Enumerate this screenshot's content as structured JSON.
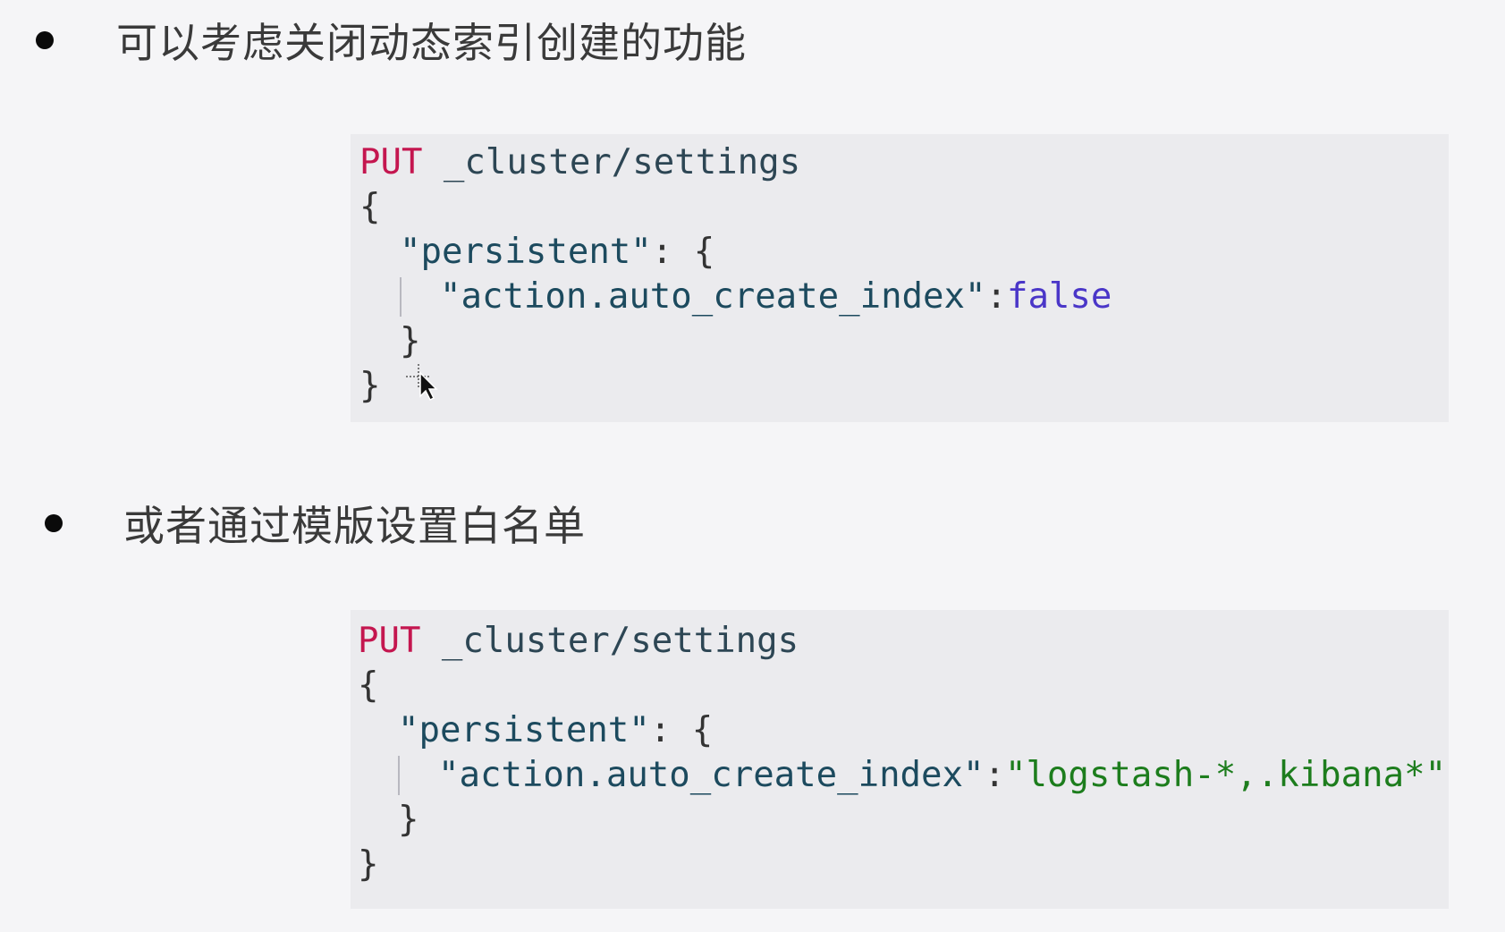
{
  "bullets": [
    {
      "text": "可以考虑关闭动态索引创建的功能"
    },
    {
      "text": "或者通过模版设置白名单"
    }
  ],
  "code_blocks": [
    {
      "method": "PUT",
      "path": " _cluster/settings",
      "open_brace": "{",
      "persistent_key": "\"persistent\"",
      "persistent_sep": ": {",
      "setting_key": "\"action.auto_create_index\"",
      "setting_sep": ":",
      "setting_value": "false",
      "inner_close": "}",
      "outer_close": "}"
    },
    {
      "method": "PUT",
      "path": " _cluster/settings",
      "open_brace": "{",
      "persistent_key": "\"persistent\"",
      "persistent_sep": ": {",
      "setting_key": "\"action.auto_create_index\"",
      "setting_sep": ":",
      "setting_value": "\"logstash-*,.kibana*\"",
      "inner_close": "}",
      "outer_close": "}"
    }
  ],
  "colors": {
    "method": "#c4164f",
    "boolean": "#4a36c8",
    "string": "#1d7d1d"
  },
  "icons": {
    "cursor": "move-pointer-icon"
  }
}
